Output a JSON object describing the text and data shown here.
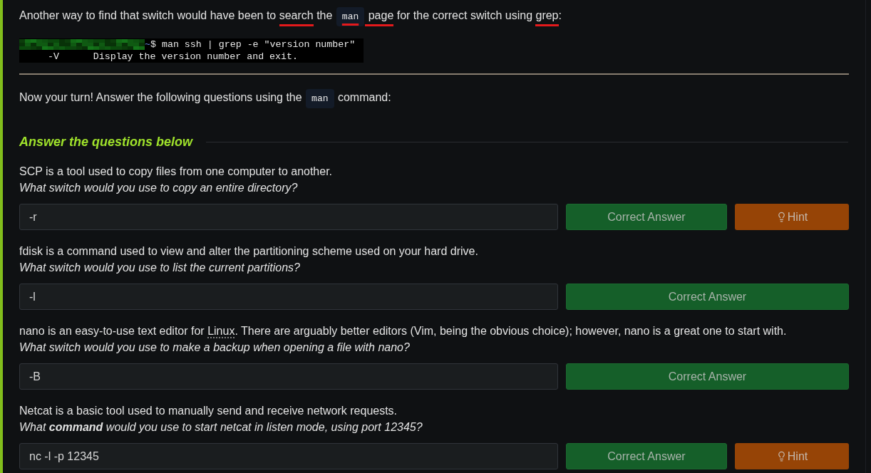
{
  "intro_paragraph": {
    "segments": [
      {
        "kind": "text",
        "text": "Another way to find that switch would have been to ",
        "marked": false
      },
      {
        "kind": "text",
        "text": "search",
        "marked": true
      },
      {
        "kind": "text",
        "text": " the ",
        "marked": false
      },
      {
        "kind": "code",
        "text": "man",
        "marked": true
      },
      {
        "kind": "text",
        "text": " page",
        "marked": true
      },
      {
        "kind": "text",
        "text": " for the correct switch using ",
        "marked": false
      },
      {
        "kind": "text",
        "text": "grep",
        "marked": true
      },
      {
        "kind": "text",
        "text": ":",
        "marked": false
      }
    ]
  },
  "terminal": {
    "lines": [
      {
        "kind": "command",
        "redacted": true,
        "prompt": "~",
        "text": "$ man ssh | grep -e \"version number\""
      },
      {
        "kind": "output",
        "redacted": false,
        "text": "     -V      Display the version number and exit."
      }
    ]
  },
  "instruction": {
    "segments": [
      {
        "kind": "text",
        "text": "Now your turn! Answer the following questions using the "
      },
      {
        "kind": "code",
        "text": "man"
      },
      {
        "kind": "text",
        "text": " command:"
      }
    ]
  },
  "section_heading": "Answer the questions below",
  "questions": [
    {
      "intro": [
        {
          "kind": "text",
          "text": "SCP is a tool used to copy files from one computer to another."
        }
      ],
      "question": "What switch would you use to copy an entire directory?",
      "answer": "-r",
      "correct": true,
      "submit_label": "Correct Answer",
      "hint_label": "Hint"
    },
    {
      "intro": [
        {
          "kind": "text",
          "text": "fdisk is a command used to view and alter the partitioning scheme used on your hard drive."
        }
      ],
      "question": "What switch would you use to list the current partitions?",
      "answer": "-l",
      "correct": true,
      "submit_label": "Correct Answer"
    },
    {
      "intro": [
        {
          "kind": "text",
          "text": "nano is an easy-to-use text editor for "
        },
        {
          "kind": "link",
          "text": "Linux"
        },
        {
          "kind": "text",
          "text": ". There are arguably better editors (Vim, being the obvious choice); however, nano is a great one to start with."
        }
      ],
      "question": "What switch would you use to make a backup when opening a file with nano?",
      "answer": "-B",
      "correct": true,
      "submit_label": "Correct Answer"
    },
    {
      "intro": [
        {
          "kind": "text",
          "text": "Netcat is a basic tool used to manually send and receive network requests."
        }
      ],
      "question": "What **command** would you use to start netcat in listen mode, using port 12345?",
      "answer": "nc -l -p 12345",
      "correct": true,
      "submit_label": "Correct Answer",
      "hint_label": "Hint"
    }
  ]
}
